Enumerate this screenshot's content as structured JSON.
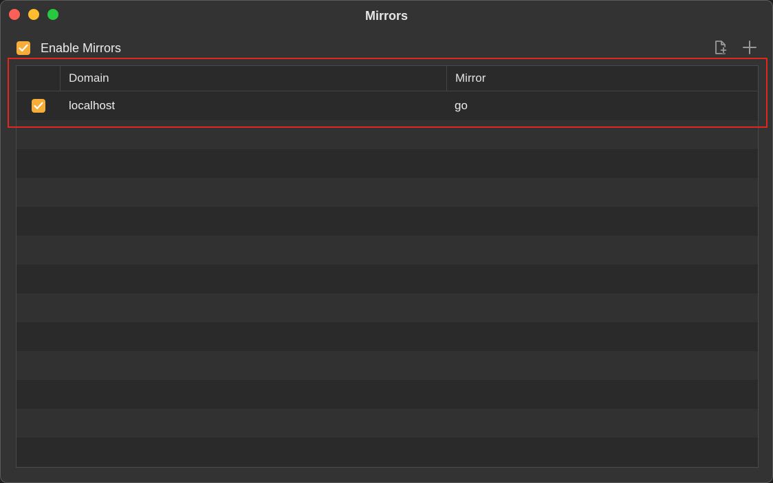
{
  "window": {
    "title": "Mirrors"
  },
  "enable_mirrors": {
    "label": "Enable Mirrors",
    "checked": true
  },
  "toolbar": {
    "icons": [
      "new-document-icon",
      "plus-icon"
    ]
  },
  "table": {
    "columns": [
      "",
      "Domain",
      "Mirror"
    ],
    "rows": [
      {
        "enabled": true,
        "domain": "localhost",
        "mirror": "go"
      }
    ]
  },
  "colors": {
    "accent_checkbox": "#f6ad3a",
    "highlight_box": "#e2271c",
    "window_bg": "#333333",
    "table_bg": "#2a2a2a",
    "stripe_alt": "#313131"
  }
}
